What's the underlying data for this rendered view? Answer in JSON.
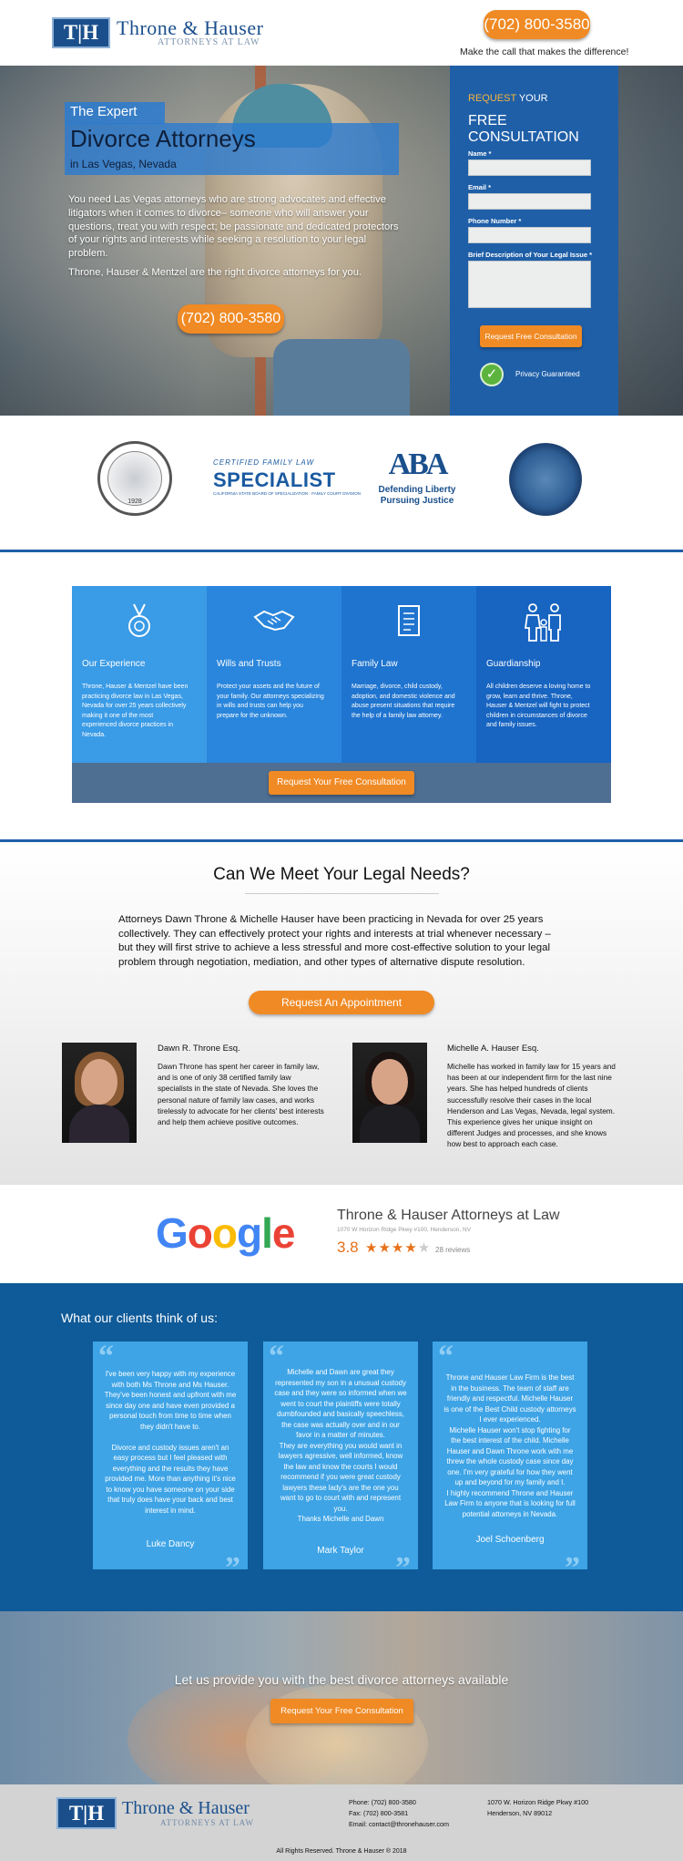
{
  "header": {
    "logo_mark": "T|H",
    "logo_name": "Throne & Hauser",
    "logo_sub": "ATTORNEYS AT LAW",
    "phone": "(702) 800-3580",
    "tagline": "Make the call that makes the difference!"
  },
  "hero": {
    "kicker": "The Expert",
    "title": "Divorce Attorneys",
    "subtitle": "in Las Vegas, Nevada",
    "paragraph1": "You need Las Vegas attorneys who are strong advocates and effective litigators when it comes to divorce– someone who will answer your questions, treat you with respect; be passionate and dedicated protectors of your rights and interests while seeking a resolution to your legal problem.",
    "paragraph2": "Throne, Hauser & Mentzel are the right divorce attorneys for you.",
    "phone": "(702) 800-3580"
  },
  "form": {
    "heading_accent": "REQUEST",
    "heading_rest": " YOUR",
    "heading2": "FREE CONSULTATION",
    "name_label": "Name *",
    "email_label": "Email *",
    "phone_label": "Phone Number *",
    "issue_label": "Brief Description of Your Legal Issue *",
    "submit_label": "Request Free Consultation",
    "privacy": "Privacy Guaranteed"
  },
  "badges": {
    "bar_year": "1928",
    "cert_top": "CERTIFIED FAMILY LAW",
    "cert_big": "SPECIALIST",
    "cert_small": "CALIFORNIA STATE BOARD OF SPECIALIZATION · FAMILY COURT DIVISION",
    "aba_mark": "ABA",
    "aba_line1": "Defending Liberty",
    "aba_line2": "Pursuing Justice"
  },
  "services": {
    "items": [
      {
        "icon": "medal-icon",
        "title": "Our Experience",
        "text": "Throne, Hauser & Mentzel have been practicing divorce law in Las Vegas, Nevada for over 25 years collectively making it one of the most experienced divorce practices in Nevada.",
        "color": "#3a9be6"
      },
      {
        "icon": "handshake-icon",
        "title": "Wills and Trusts",
        "text": "Protect your assets and the future of your family. Our attorneys specializing in wills and trusts can help you prepare for the unknown.",
        "color": "#2a86dc"
      },
      {
        "icon": "document-icon",
        "title": "Family Law",
        "text": "Marriage, divorce, child custody, adoption, and domestic violence and abuse present situations that require the help of a family law attorney.",
        "color": "#1f74cf"
      },
      {
        "icon": "family-icon",
        "title": "Guardianship",
        "text": "All children deserve a loving home to grow, learn and thrive. Throne, Hauser & Mentzel will fight to protect children in circumstances of divorce and family issues.",
        "color": "#1764c1"
      }
    ],
    "button_label": "Request Your Free Consultation"
  },
  "legal": {
    "title": "Can We Meet Your Legal Needs?",
    "body": "Attorneys Dawn Throne & Michelle Hauser have been practicing in Nevada for over 25 years collectively. They can effectively protect your rights and interests at trial whenever necessary – but they will first strive to achieve a less stressful and more cost-effective solution to your legal problem through negotiation, mediation, and other types of alternative dispute resolution.",
    "button_label": "Request An Appointment",
    "attorneys": [
      {
        "name": "Dawn R. Throne Esq.",
        "bio": "Dawn Throne has spent her career in family law, and is one of only 38 certified family law specialists in the state of Nevada. She loves the personal nature of family law cases, and works tirelessly to advocate for her clients' best interests and help them achieve positive outcomes."
      },
      {
        "name": "Michelle A. Hauser Esq.",
        "bio": "Michelle has worked in family law for 15 years and has been at our independent firm for the last nine years. She has helped hundreds of clients successfully resolve their cases in the local Henderson and Las Vegas, Nevada, legal system. This experience gives her unique insight on different Judges and processes, and she knows how best to approach each case."
      }
    ]
  },
  "google": {
    "logo": "Google",
    "business_name": "Throne & Hauser Attorneys at Law",
    "address": "1070 W Horizon Ridge Pkwy #100, Henderson, NV",
    "rating": "3.8",
    "stars_on": "★★★★",
    "stars_off": "★",
    "star_rating": 3.8,
    "reviews": "28 reviews"
  },
  "testimonials": {
    "title": "What our clients think of us:",
    "items": [
      {
        "text": "I've been very happy with my experience with both Ms Throne and Ms Hauser. They've been honest and upfront with me since day one and have even provided a personal touch from time to time when they didn't have to.\n\nDivorce and custody issues aren't an easy process but I feel pleased with everything and the results they have provided me. More than anything it's nice to know you have someone on your side that truly does have your back and best interest in mind.",
        "name": "Luke Dancy"
      },
      {
        "text": "Michelle and Dawn are great they represented my son in a unusual custody case and they were so informed when we went to court the plaintiffs were totally dumbfounded and basically speechless, the case was actually over and in our favor in a matter of minutes.\nThey are everything you would want in lawyers agressive, well informed, know the law and know the courts I would recommend if you were great custody lawyers these lady's are the one you want to go to court with and represent you.\nThanks Michelle and Dawn",
        "name": "Mark Taylor"
      },
      {
        "text": "Throne and Hauser Law Firm is the best in the business. The team of staff are friendly and respectful. Michelle Hauser is one of the Best Child custody attorneys I ever experienced.\nMichelle Hauser won't stop fighting for the best interest of the child. Michelle Hauser and Dawn Throne work with me threw the whole custody case since day one. I'm very grateful for how they went up and beyond for my family and I.\nI highly recommend Throne and Hauser Law Firm to anyone that is looking for full potential attorneys in Nevada.",
        "name": "Joel Schoenberg"
      }
    ]
  },
  "cta": {
    "text": "Let us provide you with the best divorce attorneys available",
    "button_label": "Request Your Free Consultation"
  },
  "footer": {
    "logo_mark": "T|H",
    "logo_name": "Throne & Hauser",
    "logo_sub": "ATTORNEYS AT LAW",
    "phone": "Phone: (702) 800-3580",
    "fax": "Fax: (702) 800-3581",
    "email": "Email: contact@thronehauser.com",
    "address1": "1070 W. Horizon Ridge Pkwy #100",
    "address2": "Henderson, NV 89012",
    "copyright": "All Rights Reserved. Throne & Hauser ® 2018"
  },
  "colors": {
    "brand_blue": "#1a4f8c",
    "accent_orange": "#f08a24",
    "form_blue": "#1f5fa8",
    "testimonial_bg": "#0f5a98"
  }
}
